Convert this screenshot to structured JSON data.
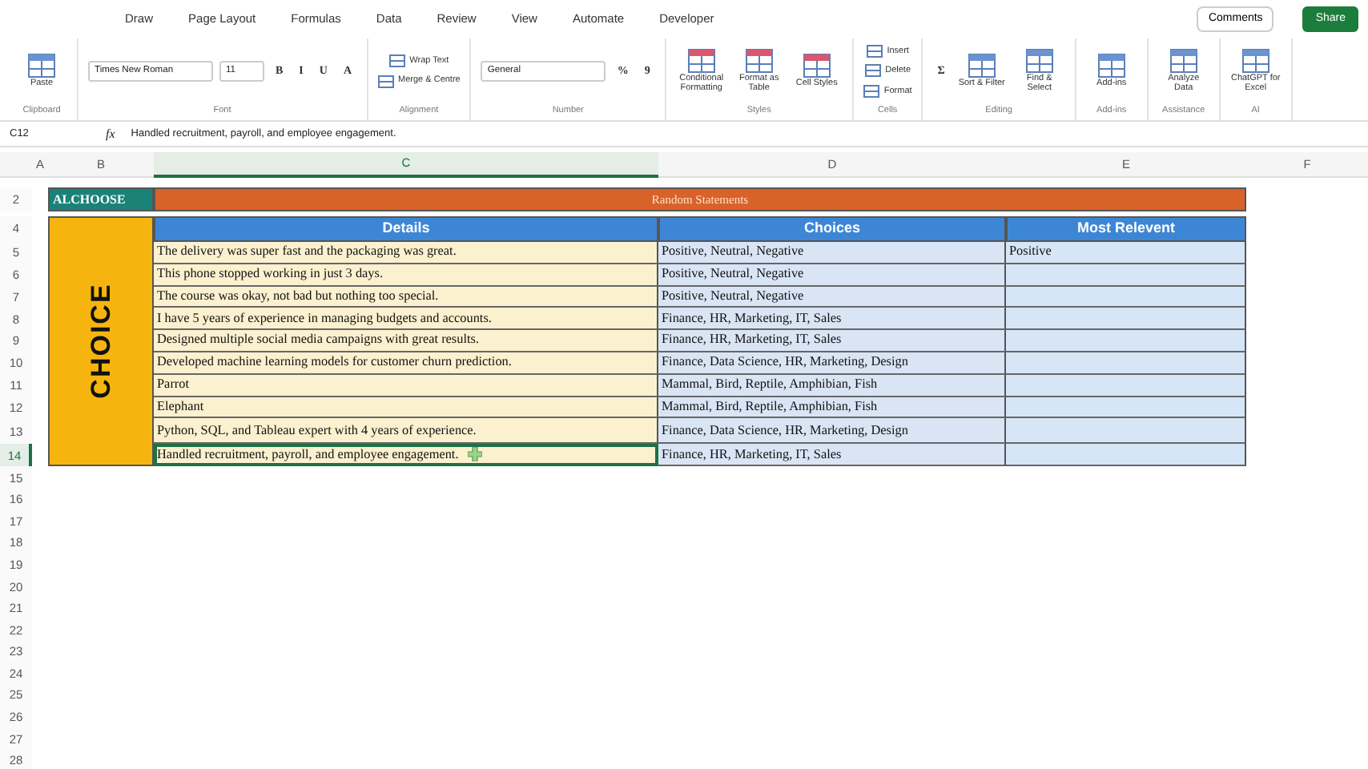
{
  "ribbon": {
    "tabs": [
      {
        "label": "Draw",
        "selected": false
      },
      {
        "label": "Page Layout",
        "selected": false
      },
      {
        "label": "Formulas",
        "selected": false
      },
      {
        "label": "Data",
        "selected": false
      },
      {
        "label": "Review",
        "selected": false
      },
      {
        "label": "View",
        "selected": false
      },
      {
        "label": "Automate",
        "selected": false
      },
      {
        "label": "Developer",
        "selected": false
      }
    ],
    "comments": "Comments",
    "share": "Share",
    "groups": [
      {
        "label": "Clipboard",
        "items": [
          {
            "kind": "large",
            "label": "Paste"
          }
        ]
      },
      {
        "label": "Font",
        "items": [
          {
            "kind": "dropdown",
            "value": "Times New Roman",
            "wide": true
          },
          {
            "kind": "dropdown",
            "value": "11",
            "wide": false
          },
          {
            "kind": "glyph",
            "text": "B"
          },
          {
            "kind": "glyph",
            "text": "I"
          },
          {
            "kind": "glyph",
            "text": "U"
          },
          {
            "kind": "glyph",
            "text": "A"
          }
        ]
      },
      {
        "label": "Alignment",
        "items": [
          {
            "kind": "small",
            "label": "Wrap Text"
          },
          {
            "kind": "small",
            "label": "Merge & Centre"
          }
        ]
      },
      {
        "label": "Number",
        "items": [
          {
            "kind": "dropdown",
            "value": "General",
            "wide": true
          },
          {
            "kind": "glyph",
            "text": "%"
          },
          {
            "kind": "glyph",
            "text": "9"
          }
        ]
      },
      {
        "label": "Styles",
        "items": [
          {
            "kind": "large",
            "label": "Conditional Formatting"
          },
          {
            "kind": "large",
            "label": "Format as Table"
          },
          {
            "kind": "large",
            "label": "Cell Styles"
          }
        ]
      },
      {
        "label": "Cells",
        "items": [
          {
            "kind": "small",
            "label": "Insert"
          },
          {
            "kind": "small",
            "label": "Delete"
          },
          {
            "kind": "small",
            "label": "Format"
          }
        ]
      },
      {
        "label": "Editing",
        "items": [
          {
            "kind": "glyph",
            "text": "Σ"
          },
          {
            "kind": "large",
            "label": "Sort & Filter"
          },
          {
            "kind": "large",
            "label": "Find & Select"
          }
        ]
      },
      {
        "label": "Add-ins",
        "items": [
          {
            "kind": "large",
            "label": "Add-ins"
          }
        ]
      },
      {
        "label": "Assistance",
        "items": [
          {
            "kind": "large",
            "label": "Analyze Data"
          }
        ]
      },
      {
        "label": "AI",
        "items": [
          {
            "kind": "large",
            "label": "ChatGPT for Excel"
          }
        ]
      }
    ]
  },
  "formula_bar": {
    "name_box": "C12",
    "fx": "fx",
    "formula": "Handled recruitment, payroll, and employee engagement."
  },
  "sheet": {
    "columns": [
      {
        "label": "A",
        "selected": false
      },
      {
        "label": "B",
        "selected": false
      },
      {
        "label": "C",
        "selected": true
      },
      {
        "label": "D",
        "selected": false
      },
      {
        "label": "E",
        "selected": false
      },
      {
        "label": "F",
        "selected": false
      }
    ],
    "rows": [
      {
        "label": "2",
        "selected": false
      },
      {
        "label": "4",
        "selected": false
      },
      {
        "label": "5",
        "selected": false
      },
      {
        "label": "6",
        "selected": false
      },
      {
        "label": "7",
        "selected": false
      },
      {
        "label": "8",
        "selected": false
      },
      {
        "label": "9",
        "selected": false
      },
      {
        "label": "10",
        "selected": false
      },
      {
        "label": "11",
        "selected": false
      },
      {
        "label": "12",
        "selected": false
      },
      {
        "label": "13",
        "selected": false
      },
      {
        "label": "14",
        "selected": true
      },
      {
        "label": "15",
        "selected": false
      },
      {
        "label": "16",
        "selected": false
      },
      {
        "label": "17",
        "selected": false
      },
      {
        "label": "18",
        "selected": false
      },
      {
        "label": "19",
        "selected": false
      },
      {
        "label": "20",
        "selected": false
      },
      {
        "label": "21",
        "selected": false
      },
      {
        "label": "22",
        "selected": false
      },
      {
        "label": "23",
        "selected": false
      },
      {
        "label": "24",
        "selected": false
      },
      {
        "label": "25",
        "selected": false
      },
      {
        "label": "26",
        "selected": false
      },
      {
        "label": "27",
        "selected": false
      },
      {
        "label": "28",
        "selected": false
      }
    ],
    "brand": "ALCHOOSE",
    "banner": "Random Statements",
    "side_label": "CHOICE",
    "headers": [
      "Details",
      "Choices",
      "Most Relevent"
    ],
    "records": [
      {
        "details": "The delivery was super fast and the packaging was great.",
        "choices": "Positive, Neutral, Negative",
        "most_relevent": "Positive",
        "selected": false
      },
      {
        "details": "This phone stopped working in just 3 days.",
        "choices": "Positive, Neutral, Negative",
        "selected": false
      },
      {
        "details": "The course was okay, not bad but nothing too special.",
        "choices": "Positive, Neutral, Negative",
        "selected": false
      },
      {
        "details": "I have 5 years of experience in managing budgets and accounts.",
        "choices": "Finance, HR, Marketing, IT, Sales",
        "selected": false
      },
      {
        "details": "Designed multiple social media campaigns with great results.",
        "choices": "Finance, HR, Marketing, IT, Sales",
        "selected": false
      },
      {
        "details": "Developed machine learning models for customer churn prediction.",
        "choices": "Finance, Data Science, HR, Marketing, Design",
        "selected": false
      },
      {
        "details": "Parrot",
        "choices": "Mammal, Bird, Reptile, Amphibian, Fish",
        "selected": false
      },
      {
        "details": "Elephant",
        "choices": "Mammal, Bird, Reptile, Amphibian, Fish",
        "selected": false
      },
      {
        "details": "Python, SQL, and Tableau expert with 4 years of experience.",
        "choices": "Finance, Data Science, HR, Marketing, Design",
        "selected": false
      },
      {
        "details": "Handled recruitment, payroll, and employee engagement.",
        "choices": "Finance, HR, Marketing, IT, Sales",
        "selected": true
      }
    ]
  }
}
